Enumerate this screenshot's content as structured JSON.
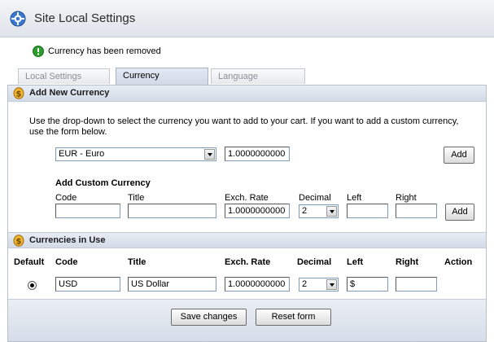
{
  "header": {
    "title": "Site Local Settings",
    "icon": "gear-icon"
  },
  "notice": {
    "text": "Currency has been removed",
    "icon": "info-icon"
  },
  "tabs": [
    {
      "label": "Local Settings",
      "active": false
    },
    {
      "label": "Currency",
      "active": true
    },
    {
      "label": "Language",
      "active": false
    }
  ],
  "add_new": {
    "title": "Add New Currency",
    "instructions": "Use the drop-down to select the currency you want to add to your cart. If you want to add a custom currency, use the form below.",
    "selected_currency": "EUR - Euro",
    "rate": "1.0000000000",
    "add_label": "Add"
  },
  "custom": {
    "title": "Add Custom Currency",
    "labels": {
      "code": "Code",
      "title": "Title",
      "rate": "Exch. Rate",
      "decimal": "Decimal",
      "left": "Left",
      "right": "Right"
    },
    "values": {
      "code": "",
      "title": "",
      "rate": "1.0000000000",
      "decimal": "2",
      "left": "",
      "right": ""
    },
    "add_label": "Add"
  },
  "in_use": {
    "title": "Currencies in Use",
    "columns": {
      "default": "Default",
      "code": "Code",
      "title": "Title",
      "rate": "Exch. Rate",
      "decimal": "Decimal",
      "left": "Left",
      "right": "Right",
      "action": "Action"
    },
    "rows": [
      {
        "default": true,
        "code": "USD",
        "title": "US Dollar",
        "rate": "1.0000000000",
        "decimal": "2",
        "left": "$",
        "right": ""
      }
    ]
  },
  "footer": {
    "save_label": "Save changes",
    "reset_label": "Reset form"
  },
  "colors": {
    "accent": "#2f6fc9",
    "bar": "#d3dbe7",
    "coin": "#e0a020"
  }
}
